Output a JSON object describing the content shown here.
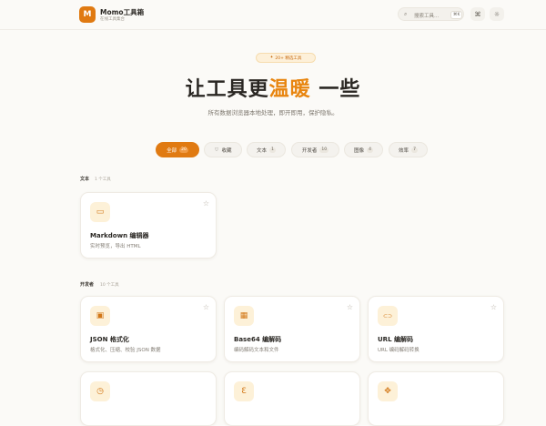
{
  "brand": {
    "logo_letter": "M",
    "name": "Momo工具箱",
    "subtitle": "在线工具集合"
  },
  "search": {
    "placeholder": "搜索工具...",
    "shortcut": "⌘K"
  },
  "header_icons": [
    "command-icon",
    "sun-icon"
  ],
  "hero": {
    "badge": "20+ 精选工具",
    "title_before": "让工具更",
    "title_highlight": "温暖",
    "title_after": " 一些",
    "subtitle": "所有数据浏览器本地处理，即开即用，保护隐私。"
  },
  "filters": [
    {
      "label": "全部",
      "count": "20",
      "active": true
    },
    {
      "label": "收藏",
      "count": "",
      "active": false
    },
    {
      "label": "文本",
      "count": "1",
      "active": false
    },
    {
      "label": "开发者",
      "count": "10",
      "active": false
    },
    {
      "label": "图像",
      "count": "4",
      "active": false
    },
    {
      "label": "效率",
      "count": "7",
      "active": false
    }
  ],
  "sections": [
    {
      "label": "文本",
      "count": "1 个工具",
      "tools": [
        {
          "icon": "markdown-icon",
          "glyph": "▭",
          "name": "Markdown 编辑器",
          "desc": "实时预览，导出 HTML"
        }
      ]
    },
    {
      "label": "开发者",
      "count": "10 个工具",
      "tools": [
        {
          "icon": "json-icon",
          "glyph": "▣",
          "name": "JSON 格式化",
          "desc": "格式化、压缩、校验 JSON 数据"
        },
        {
          "icon": "base64-icon",
          "glyph": "▦",
          "name": "Base64 编解码",
          "desc": "编码解码文本和文件"
        },
        {
          "icon": "link-icon",
          "glyph": "⊂⊃",
          "name": "URL 编解码",
          "desc": "URL 编码解码转换"
        },
        {
          "icon": "clock-icon",
          "glyph": "◷",
          "name": "",
          "desc": ""
        },
        {
          "icon": "regex-icon",
          "glyph": "Ɛ",
          "name": "",
          "desc": ""
        },
        {
          "icon": "gamepad-icon",
          "glyph": "✥",
          "name": "",
          "desc": ""
        }
      ]
    }
  ]
}
